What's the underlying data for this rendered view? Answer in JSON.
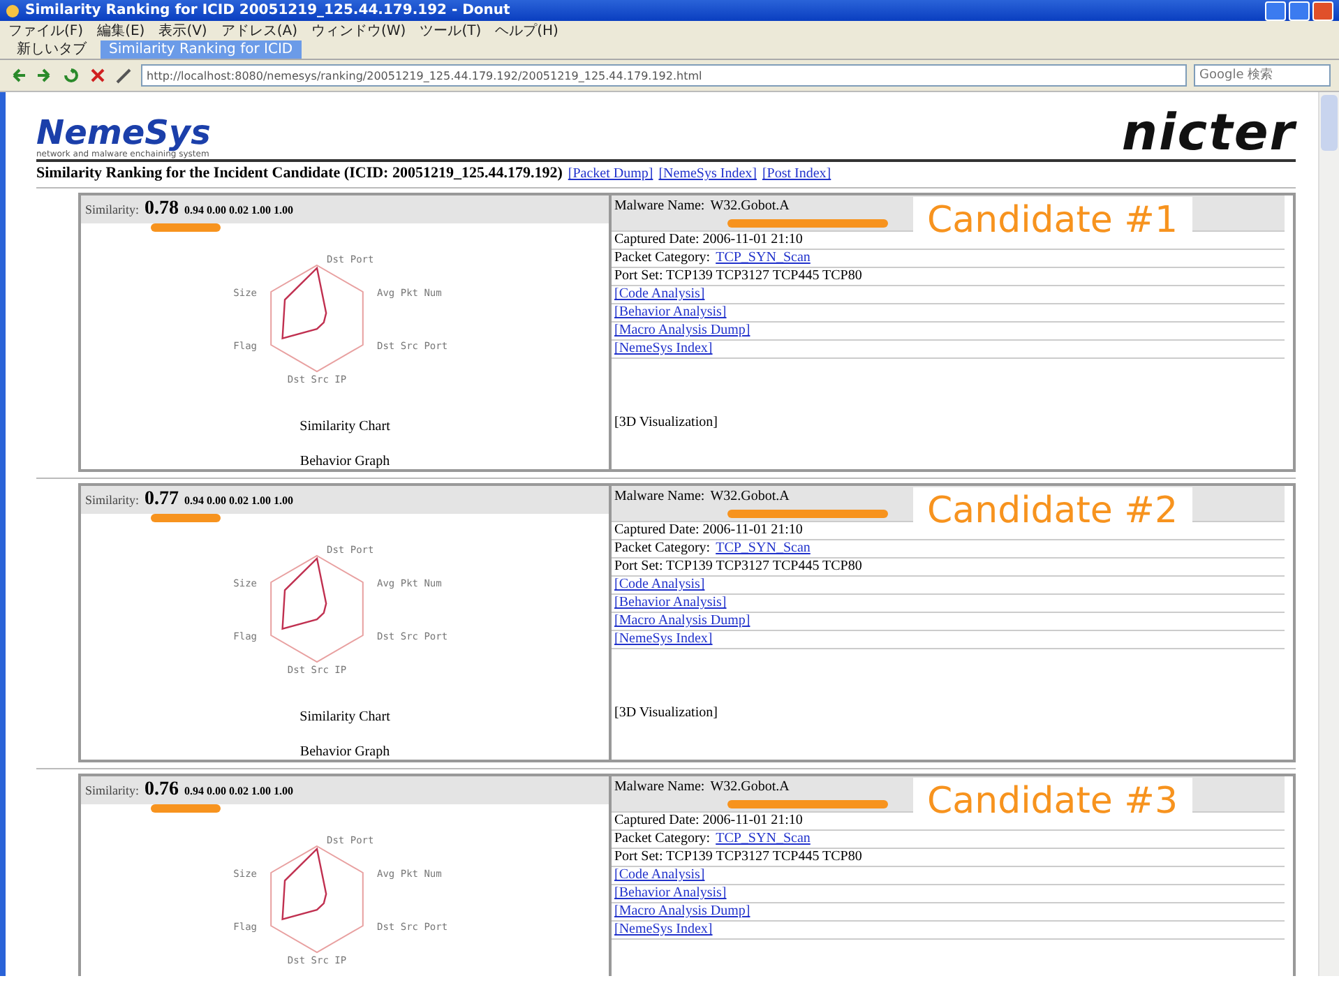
{
  "window": {
    "title": "Similarity Ranking for ICID 20051219_125.44.179.192 - Donut"
  },
  "menu": [
    "ファイル(F)",
    "編集(E)",
    "表示(V)",
    "アドレス(A)",
    "ウィンドウ(W)",
    "ツール(T)",
    "ヘルプ(H)"
  ],
  "tabs": [
    {
      "label": "新しいタブ",
      "selected": false
    },
    {
      "label": "Similarity Ranking for ICID",
      "selected": true
    }
  ],
  "toolbar": {
    "address": "http://localhost:8080/nemesys/ranking/20051219_125.44.179.192/20051219_125.44.179.192.html",
    "search_placeholder": "Google 検索"
  },
  "page": {
    "logo": "NemeSys",
    "logo_subtitle": "network and malware enchaining system",
    "brand": "nicter",
    "heading": "Similarity Ranking for the Incident Candidate (ICID: 20051219_125.44.179.192)",
    "heading_links": [
      "[Packet Dump]",
      "[NemeSys Index]",
      "[Post Index]"
    ],
    "candidates": [
      {
        "similarity_label": "Similarity:",
        "score": "0.78",
        "sub_scores": "0.94 0.00 0.02 1.00 1.00",
        "malware_label": "Malware Name:",
        "malware": "W32.Gobot.A",
        "captured": "Captured Date: 2006-11-01 21:10",
        "category_label": "Packet Category:",
        "category": "TCP_SYN_Scan",
        "ports": "Port Set: TCP139 TCP3127 TCP445 TCP80",
        "links": [
          "[Code Analysis]",
          "[Behavior Analysis]",
          "[Macro Analysis Dump]",
          "[NemeSys Index]"
        ],
        "visualization": "[3D Visualization]",
        "chart_labels": [
          "Dst Port",
          "Avg Pkt Num",
          "Dst Src Port",
          "Dst Src IP",
          "Flag",
          "Size"
        ],
        "chart_title": "Similarity Chart",
        "graph_title": "Behavior Graph",
        "annotation": "Candidate #1"
      },
      {
        "similarity_label": "Similarity:",
        "score": "0.77",
        "sub_scores": "0.94 0.00 0.02 1.00 1.00",
        "malware_label": "Malware Name:",
        "malware": "W32.Gobot.A",
        "captured": "Captured Date: 2006-11-01 21:10",
        "category_label": "Packet Category:",
        "category": "TCP_SYN_Scan",
        "ports": "Port Set: TCP139 TCP3127 TCP445 TCP80",
        "links": [
          "[Code Analysis]",
          "[Behavior Analysis]",
          "[Macro Analysis Dump]",
          "[NemeSys Index]"
        ],
        "visualization": "[3D Visualization]",
        "chart_labels": [
          "Dst Port",
          "Avg Pkt Num",
          "Dst Src Port",
          "Dst Src IP",
          "Flag",
          "Size"
        ],
        "chart_title": "Similarity Chart",
        "graph_title": "Behavior Graph",
        "annotation": "Candidate #2"
      },
      {
        "similarity_label": "Similarity:",
        "score": "0.76",
        "sub_scores": "0.94 0.00 0.02 1.00 1.00",
        "malware_label": "Malware Name:",
        "malware": "W32.Gobot.A",
        "captured": "Captured Date: 2006-11-01 21:10",
        "category_label": "Packet Category:",
        "category": "TCP_SYN_Scan",
        "ports": "Port Set: TCP139 TCP3127 TCP445 TCP80",
        "links": [
          "[Code Analysis]",
          "[Behavior Analysis]",
          "[Macro Analysis Dump]",
          "[NemeSys Index]"
        ],
        "chart_labels": [
          "Dst Port",
          "Avg Pkt Num",
          "Dst Src Port",
          "Dst Src IP",
          "Flag",
          "Size"
        ],
        "annotation": "Candidate #3"
      }
    ]
  }
}
